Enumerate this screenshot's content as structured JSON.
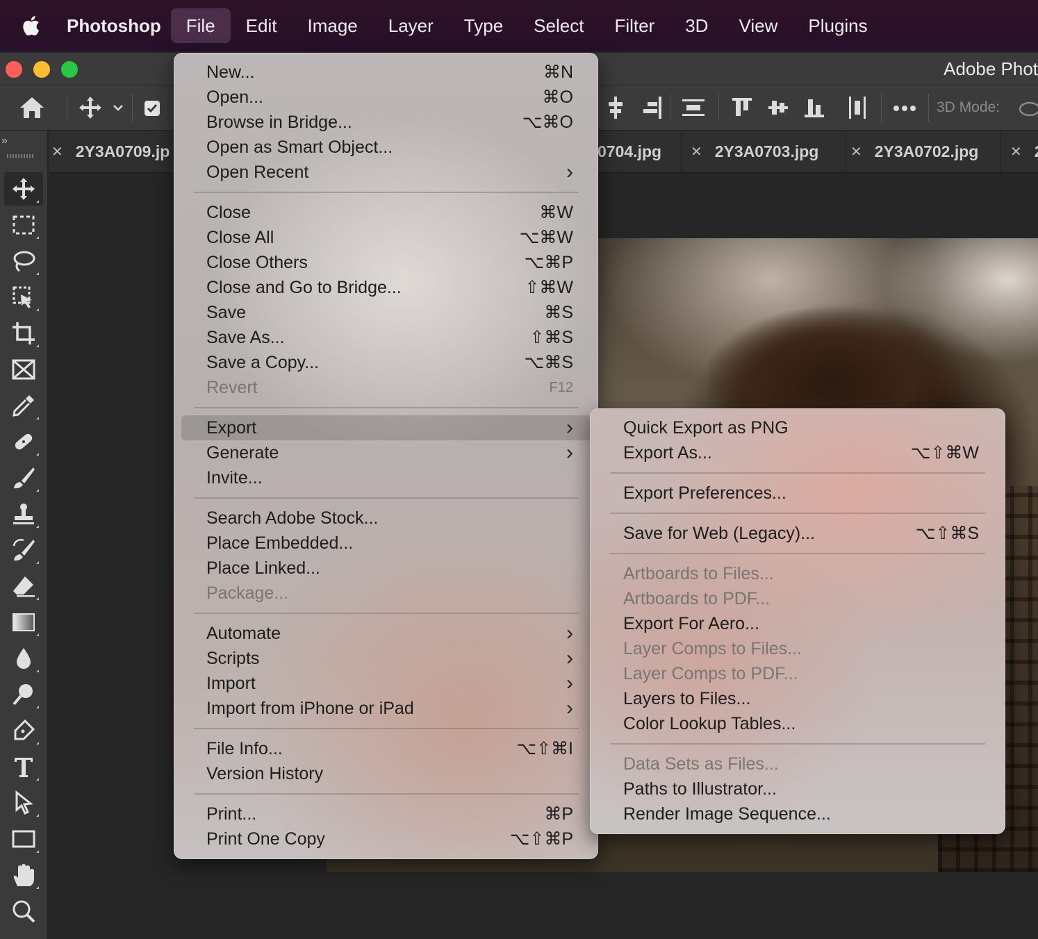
{
  "menubar": {
    "app": "Photoshop",
    "items": [
      "File",
      "Edit",
      "Image",
      "Layer",
      "Type",
      "Select",
      "Filter",
      "3D",
      "View",
      "Plugins"
    ],
    "active": "File"
  },
  "window": {
    "title": "Adobe Phot",
    "traffic_colors": {
      "close": "#ff5f57",
      "minimize": "#febc2e",
      "zoom": "#28c840"
    }
  },
  "options": {
    "mode_label": "3D Mode:"
  },
  "tabs": [
    {
      "name": "2Y3A0709.jp"
    },
    {
      "name": "0704.jpg"
    },
    {
      "name": "2Y3A0703.jpg"
    },
    {
      "name": "2Y3A0702.jpg"
    },
    {
      "name": "2"
    }
  ],
  "toolbar": {
    "tools": [
      "move-tool-icon",
      "marquee-tool-icon",
      "lasso-tool-icon",
      "object-selection-tool-icon",
      "crop-tool-icon",
      "frame-tool-icon",
      "eyedropper-tool-icon",
      "healing-brush-tool-icon",
      "brush-tool-icon",
      "clone-stamp-tool-icon",
      "history-brush-tool-icon",
      "eraser-tool-icon",
      "gradient-tool-icon",
      "blur-tool-icon",
      "dodge-tool-icon",
      "pen-tool-icon",
      "type-tool-icon",
      "path-selection-tool-icon",
      "rectangle-tool-icon",
      "hand-tool-icon",
      "zoom-tool-icon"
    ]
  },
  "file_menu": {
    "groups": [
      [
        {
          "label": "New...",
          "shortcut": "⌘N"
        },
        {
          "label": "Open...",
          "shortcut": "⌘O"
        },
        {
          "label": "Browse in Bridge...",
          "shortcut": "⌥⌘O"
        },
        {
          "label": "Open as Smart Object...",
          "shortcut": ""
        },
        {
          "label": "Open Recent",
          "shortcut": "",
          "submenu": true
        }
      ],
      [
        {
          "label": "Close",
          "shortcut": "⌘W"
        },
        {
          "label": "Close All",
          "shortcut": "⌥⌘W"
        },
        {
          "label": "Close Others",
          "shortcut": "⌥⌘P"
        },
        {
          "label": "Close and Go to Bridge...",
          "shortcut": "⇧⌘W"
        },
        {
          "label": "Save",
          "shortcut": "⌘S"
        },
        {
          "label": "Save As...",
          "shortcut": "⇧⌘S"
        },
        {
          "label": "Save a Copy...",
          "shortcut": "⌥⌘S"
        },
        {
          "label": "Revert",
          "shortcut": "F12",
          "disabled": true
        }
      ],
      [
        {
          "label": "Export",
          "shortcut": "",
          "submenu": true,
          "highlighted": true
        },
        {
          "label": "Generate",
          "shortcut": "",
          "submenu": true
        },
        {
          "label": "Invite...",
          "shortcut": ""
        }
      ],
      [
        {
          "label": "Search Adobe Stock...",
          "shortcut": ""
        },
        {
          "label": "Place Embedded...",
          "shortcut": ""
        },
        {
          "label": "Place Linked...",
          "shortcut": ""
        },
        {
          "label": "Package...",
          "shortcut": "",
          "disabled": true
        }
      ],
      [
        {
          "label": "Automate",
          "shortcut": "",
          "submenu": true
        },
        {
          "label": "Scripts",
          "shortcut": "",
          "submenu": true
        },
        {
          "label": "Import",
          "shortcut": "",
          "submenu": true
        },
        {
          "label": "Import from iPhone or iPad",
          "shortcut": "",
          "submenu": true
        }
      ],
      [
        {
          "label": "File Info...",
          "shortcut": "⌥⇧⌘I"
        },
        {
          "label": "Version History",
          "shortcut": ""
        }
      ],
      [
        {
          "label": "Print...",
          "shortcut": "⌘P"
        },
        {
          "label": "Print One Copy",
          "shortcut": "⌥⇧⌘P"
        }
      ]
    ]
  },
  "export_menu": {
    "groups": [
      [
        {
          "label": "Quick Export as PNG",
          "shortcut": ""
        },
        {
          "label": "Export As...",
          "shortcut": "⌥⇧⌘W"
        }
      ],
      [
        {
          "label": "Export Preferences...",
          "shortcut": ""
        }
      ],
      [
        {
          "label": "Save for Web (Legacy)...",
          "shortcut": "⌥⇧⌘S"
        }
      ],
      [
        {
          "label": "Artboards to Files...",
          "shortcut": "",
          "disabled": true
        },
        {
          "label": "Artboards to PDF...",
          "shortcut": "",
          "disabled": true
        },
        {
          "label": "Export For Aero...",
          "shortcut": ""
        },
        {
          "label": "Layer Comps to Files...",
          "shortcut": "",
          "disabled": true
        },
        {
          "label": "Layer Comps to PDF...",
          "shortcut": "",
          "disabled": true
        },
        {
          "label": "Layers to Files...",
          "shortcut": ""
        },
        {
          "label": "Color Lookup Tables...",
          "shortcut": ""
        }
      ],
      [
        {
          "label": "Data Sets as Files...",
          "shortcut": "",
          "disabled": true
        },
        {
          "label": "Paths to Illustrator...",
          "shortcut": ""
        },
        {
          "label": "Render Image Sequence...",
          "shortcut": ""
        }
      ]
    ]
  }
}
